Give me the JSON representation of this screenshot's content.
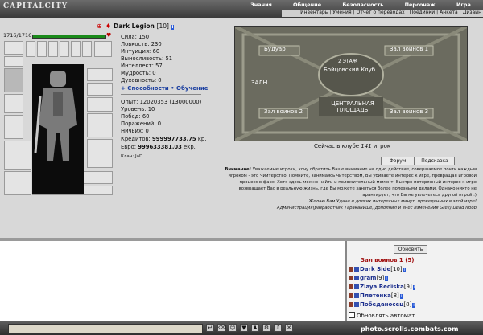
{
  "app": {
    "logo": "CAPITALCITY"
  },
  "menu": {
    "main": [
      "Знания",
      "Общение",
      "Безопасность",
      "Персонаж",
      "Игра"
    ],
    "sub": [
      "Инвентарь",
      "Умения",
      "Отчет о переводах",
      "Поединки",
      "Анкета",
      "Дизайн"
    ]
  },
  "character": {
    "hp": "1716/1716",
    "name": "Dark Legion",
    "level": "[10]",
    "badge": "i",
    "stats": [
      {
        "label": "Сила:",
        "value": "150"
      },
      {
        "label": "Ловкость:",
        "value": "230"
      },
      {
        "label": "Интуиция:",
        "value": "60"
      },
      {
        "label": "Выносливость:",
        "value": "51"
      },
      {
        "label": "Интеллект:",
        "value": "57"
      },
      {
        "label": "Мудрость:",
        "value": "0"
      },
      {
        "label": "Духовность:",
        "value": "0"
      }
    ],
    "links": {
      "abilities": "+ Способности",
      "training": "• Обучение"
    },
    "info": [
      {
        "label": "Опыт:",
        "value": "12020353 (13000000)"
      },
      {
        "label": "Уровень:",
        "value": "10"
      },
      {
        "label": "Побед:",
        "value": "60"
      },
      {
        "label": "Поражений:",
        "value": "0"
      },
      {
        "label": "Ничьих:",
        "value": "0"
      },
      {
        "label": "Кредитов:",
        "value": "999997733.75",
        "unit": "кр."
      },
      {
        "label": "Евро:",
        "value": "999633381.03",
        "unit": "екр."
      }
    ],
    "clan": "Клан: JaD"
  },
  "map": {
    "rooms": [
      "Будуар",
      "Зал воинов 1",
      "Зал воинов 2",
      "Зал воинов 3"
    ],
    "center_top": "2 ЭТАЖ",
    "center_mid": "Бойцовский Клуб",
    "halls": "ЗАЛЫ",
    "center_bottom": "ЦЕНТРАЛЬНАЯ ПЛОЩАДЬ"
  },
  "online": {
    "prefix": "Сейчас в клубе",
    "count": "141",
    "suffix": "игрок"
  },
  "buttons": {
    "forum": "Форум",
    "help": "Подсказка"
  },
  "notice": {
    "line1_bold": "Внимание!",
    "line1": " Уважаемые игроки, хочу обратить Ваше внимание на одно действие, совершаемое почти каждым",
    "line2": "игроком - это Чиитерство. Помните, занимаясь читерством, Вы убиваете интерес к игре, превращая игровой",
    "line3": "процесс в фарс. Хотя здесь можно найти и положительный момент. Быстро потерянный интерес к игре",
    "line4": "возвращает Вас в реальную жизнь, где Вы можете заняться более полезными делами. Однако никто не",
    "line5": "гарантирует, что Вы не увлечетесь другой игрой :)",
    "line6": "Желаю Вам Удачи и долгих интересных минут, проведенных в этой игре!",
    "line7": "Администрация(разработчик Тараканище, дополнил и внес изменения Grek),Dead Noob"
  },
  "room_panel": {
    "refresh": "Обновить",
    "title": "Зал воинов 1 (5)",
    "players": [
      {
        "name": "Dark Side",
        "level": "[10]"
      },
      {
        "name": "gram",
        "level": "[9]"
      },
      {
        "name": "Zlaya Rediska",
        "level": "[9]"
      },
      {
        "name": "Плетенка",
        "level": "[8]"
      },
      {
        "name": "Победаносец",
        "level": "[8]"
      }
    ],
    "badge": "i",
    "auto_refresh": "Обновлять автомат."
  },
  "watermark": "photo.scrolls.combats.com"
}
